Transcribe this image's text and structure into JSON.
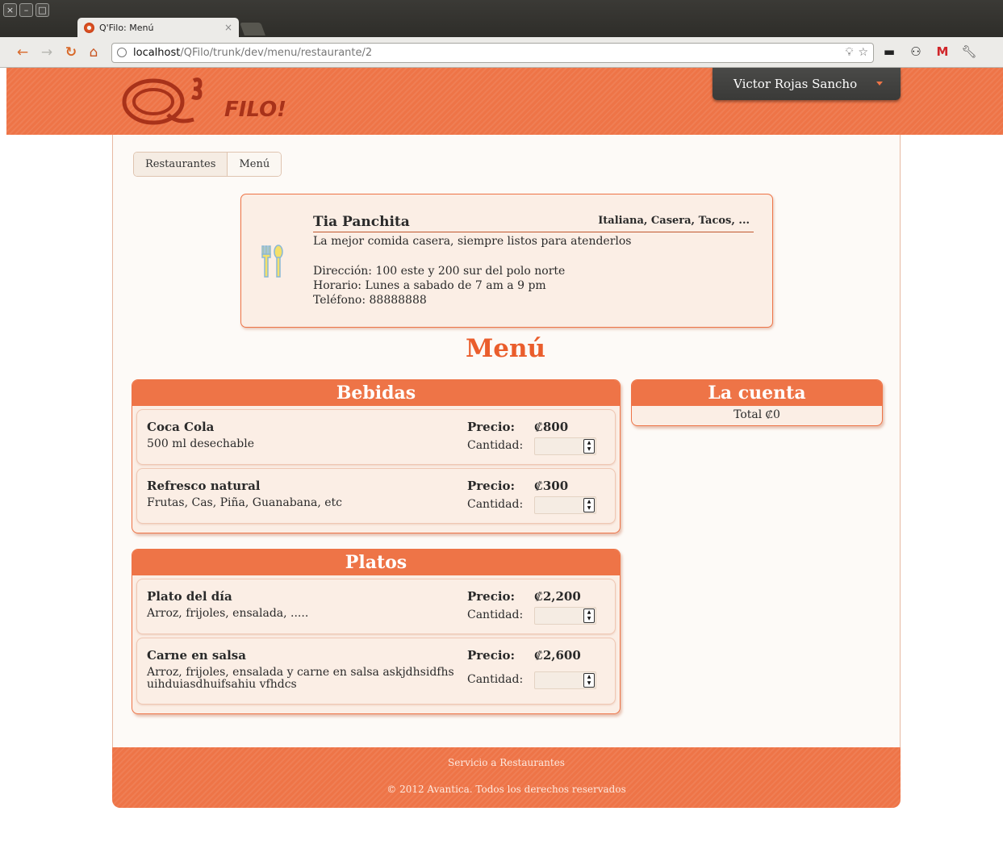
{
  "browser": {
    "tab_title": "Q'Filo: Menú",
    "tab_close": "×",
    "url_host": "localhost",
    "url_path": "/QFilo/trunk/dev/menu/restaurante/2",
    "win_close": "×",
    "win_min": "–",
    "win_max": "□"
  },
  "header": {
    "logo_text": "FILO!",
    "user_name": "Victor Rojas Sancho"
  },
  "breadcrumb": [
    "Restaurantes",
    "Menú"
  ],
  "restaurant": {
    "name": "Tia Panchita",
    "tags": "Italiana, Casera, Tacos, ...",
    "description": "La mejor comida casera, siempre listos para atenderlos",
    "address": "Dirección: 100 este y 200 sur del polo norte",
    "hours": "Horario: Lunes a sabado de 7 am a 9 pm",
    "phone": "Teléfono: 88888888"
  },
  "menu_title": "Menú",
  "sections": [
    {
      "title": "Bebidas",
      "items": [
        {
          "name": "Coca Cola",
          "description": "500 ml desechable",
          "price_label": "Precio:",
          "price": "₡800",
          "qty_label": "Cantidad:"
        },
        {
          "name": "Refresco natural",
          "description": "Frutas, Cas, Piña, Guanabana, etc",
          "price_label": "Precio:",
          "price": "₡300",
          "qty_label": "Cantidad:"
        }
      ]
    },
    {
      "title": "Platos",
      "items": [
        {
          "name": "Plato del día",
          "description": "Arroz, frijoles, ensalada, .....",
          "price_label": "Precio:",
          "price": "₡2,200",
          "qty_label": "Cantidad:"
        },
        {
          "name": "Carne en salsa",
          "description": "Arroz, frijoles, ensalada y carne en salsa askjdhsidfhs uihduiasdhuifsahiu vfhdcs",
          "price_label": "Precio:",
          "price": "₡2,600",
          "qty_label": "Cantidad:"
        }
      ]
    }
  ],
  "cuenta": {
    "title": "La cuenta",
    "total": "Total ₡0"
  },
  "footer": {
    "line1": "Servicio a Restaurantes",
    "line2": "© 2012 Avantica. Todos los derechos reservados"
  },
  "colors": {
    "brand": "#ee7447",
    "menu_title": "#ea5d2c",
    "card_bg": "#fbeee5",
    "user_menu_bg": "#3f3f3d"
  }
}
